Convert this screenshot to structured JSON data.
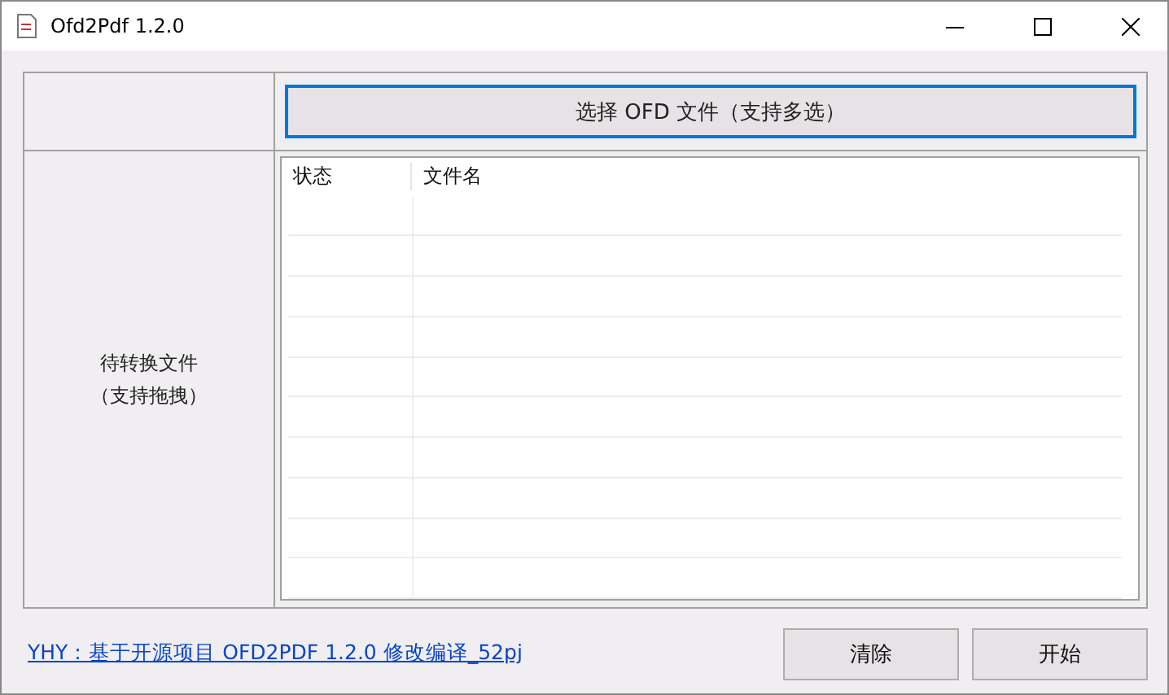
{
  "window": {
    "title": "Ofd2Pdf 1.2.0"
  },
  "select_button": {
    "label": "选择 OFD 文件（支持多选）",
    "focused": true
  },
  "file_list": {
    "label_lines": [
      "待转换文件",
      "（支持拖拽）"
    ],
    "columns": [
      "状态",
      "文件名"
    ]
  },
  "footer_link": "YHY：基于开源项目 OFD2PDF 1.2.0 修改编译_52pj",
  "buttons": [
    "清除",
    "开始"
  ]
}
